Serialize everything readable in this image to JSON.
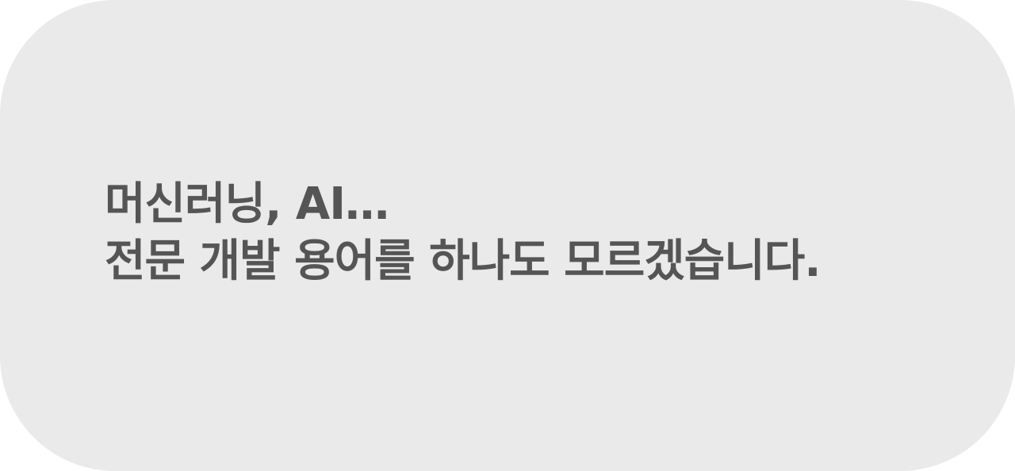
{
  "card": {
    "background_color": "#eaeaea",
    "text_color": "#555555",
    "lines": [
      "머신러닝, AI…",
      "전문 개발 용어를 하나도 모르겠습니다."
    ]
  }
}
